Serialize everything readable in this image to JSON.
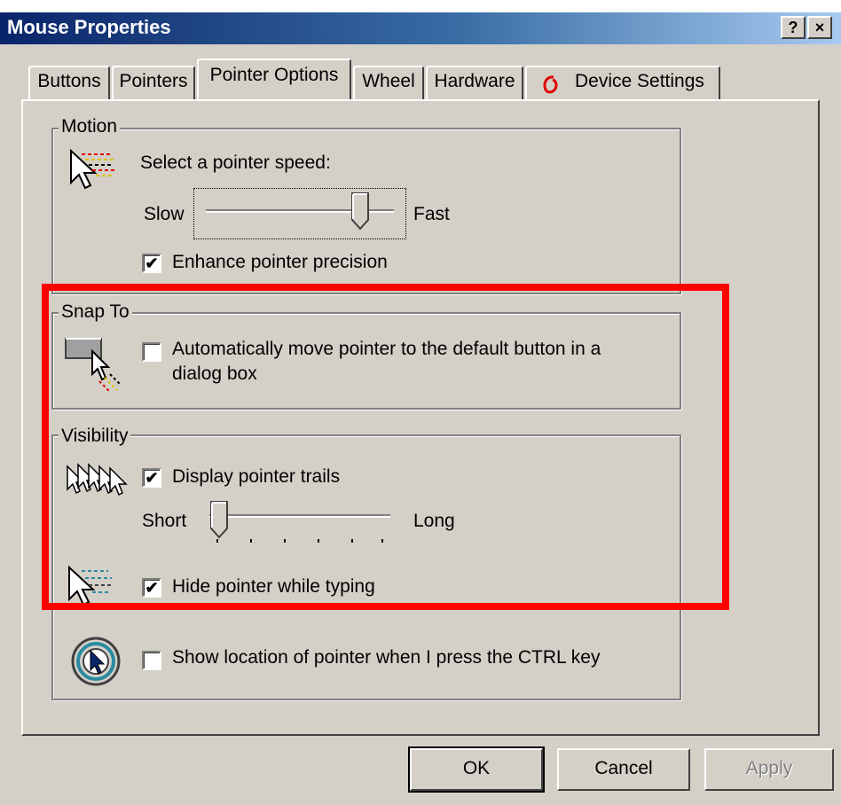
{
  "window": {
    "title": "Mouse Properties",
    "help_button": "?",
    "close_button": "×"
  },
  "tabs": [
    {
      "label": "Buttons",
      "active": false
    },
    {
      "label": "Pointers",
      "active": false
    },
    {
      "label": "Pointer Options",
      "active": true
    },
    {
      "label": "Wheel",
      "active": false
    },
    {
      "label": "Hardware",
      "active": false
    },
    {
      "label": "Device Settings",
      "active": false
    }
  ],
  "motion": {
    "group_label": "Motion",
    "speed_label": "Select a pointer speed:",
    "slow_label": "Slow",
    "fast_label": "Fast",
    "speed_level": 0.86,
    "enhance_label": "Enhance pointer precision",
    "enhance_checked": true
  },
  "snap_to": {
    "group_label": "Snap To",
    "auto_move_label_line1": "Automatically move pointer to the default button in a",
    "auto_move_label_line2": "dialog box",
    "auto_move_checked": false
  },
  "visibility": {
    "group_label": "Visibility",
    "trails_label": "Display pointer trails",
    "trails_checked": true,
    "short_label": "Short",
    "long_label": "Long",
    "trail_level": 0.0,
    "hide_label": "Hide pointer while typing",
    "hide_checked": true,
    "show_location_label": "Show location of pointer when I press the CTRL key",
    "show_location_checked": false
  },
  "buttons": {
    "ok": "OK",
    "cancel": "Cancel",
    "apply": "Apply"
  },
  "colors": {
    "highlight": "#ff0000",
    "titlebar_start": "#0a246a",
    "dialog_bg": "#d4d0c8"
  }
}
